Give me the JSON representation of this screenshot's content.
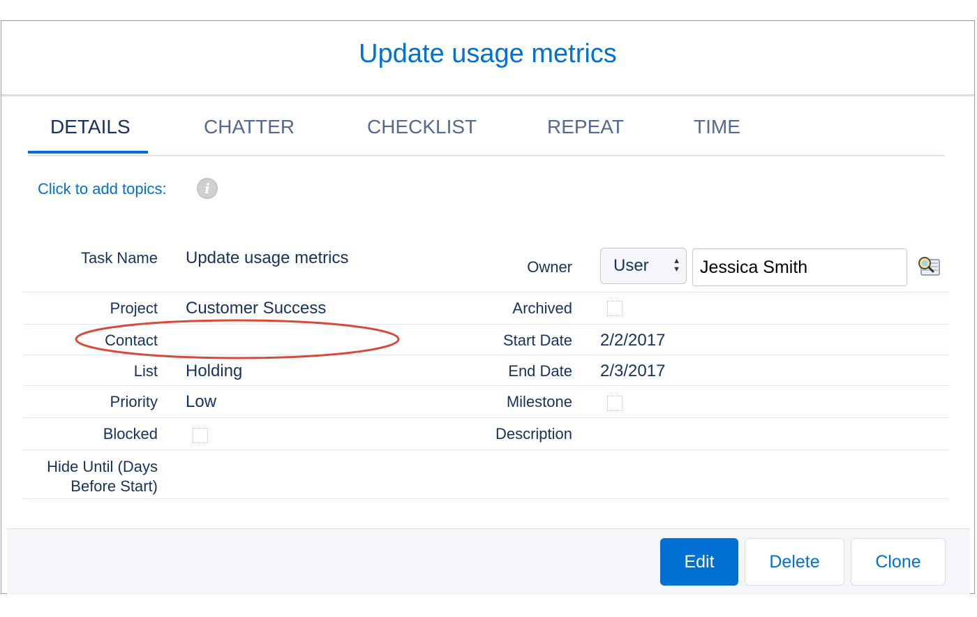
{
  "header": {
    "title": "Update usage metrics"
  },
  "tabs": [
    {
      "label": "DETAILS",
      "active": true
    },
    {
      "label": "CHATTER"
    },
    {
      "label": "CHECKLIST"
    },
    {
      "label": "REPEAT"
    },
    {
      "label": "TIME"
    }
  ],
  "topics": {
    "label": "Click to add topics:",
    "info_icon": "info-icon"
  },
  "left_fields": {
    "task_name": {
      "label": "Task Name",
      "value": "Update usage metrics"
    },
    "project": {
      "label": "Project",
      "value": "Customer Success"
    },
    "contact": {
      "label": "Contact",
      "value": ""
    },
    "list": {
      "label": "List",
      "value": "Holding"
    },
    "priority": {
      "label": "Priority",
      "value": "Low"
    },
    "blocked": {
      "label": "Blocked",
      "checked": false
    },
    "hide_until": {
      "label_line1": "Hide Until (Days",
      "label_line2": "Before Start)",
      "value": ""
    }
  },
  "right_fields": {
    "owner": {
      "label": "Owner",
      "type_selected": "User",
      "value": "Jessica Smith",
      "lookup_icon": "lookup-magnifier-icon"
    },
    "archived": {
      "label": "Archived",
      "checked": false
    },
    "start_date": {
      "label": "Start Date",
      "value": "2/2/2017"
    },
    "end_date": {
      "label": "End Date",
      "value": "2/3/2017"
    },
    "milestone": {
      "label": "Milestone",
      "checked": false
    },
    "description": {
      "label": "Description",
      "value": ""
    }
  },
  "footer": {
    "edit_label": "Edit",
    "delete_label": "Delete",
    "clone_label": "Clone"
  },
  "colors": {
    "accent": "#0070d2",
    "text": "#16325c",
    "highlight_ellipse": "#d9493a"
  }
}
